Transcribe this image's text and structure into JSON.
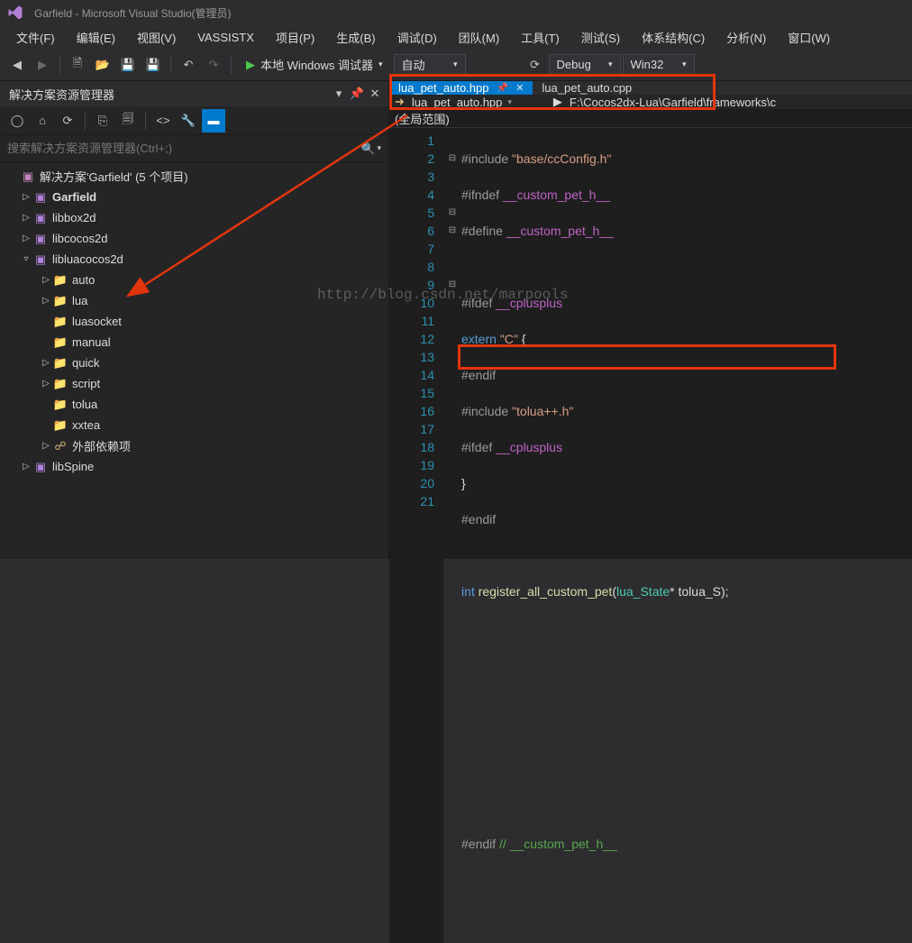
{
  "title": "Garfield - Microsoft Visual Studio(管理员)",
  "menus": {
    "file": "文件(F)",
    "edit": "编辑(E)",
    "view": "视图(V)",
    "vassist": "VASSISTX",
    "project": "项目(P)",
    "build": "生成(B)",
    "debug": "调试(D)",
    "team": "团队(M)",
    "tools": "工具(T)",
    "test": "测试(S)",
    "arch": "体系结构(C)",
    "analyze": "分析(N)",
    "window": "窗口(W)"
  },
  "toolbar": {
    "run_label": "本地 Windows 调试器",
    "mode": "自动",
    "config": "Debug",
    "platform": "Win32"
  },
  "solution_panel": {
    "title": "解决方案资源管理器",
    "search_placeholder": "搜索解决方案资源管理器(Ctrl+;)",
    "solution": "解决方案'Garfield' (5 个项目)",
    "items": [
      {
        "label": "Garfield",
        "kind": "proj",
        "bold": true,
        "expand": "▷"
      },
      {
        "label": "libbox2d",
        "kind": "proj",
        "expand": "▷"
      },
      {
        "label": "libcocos2d",
        "kind": "proj",
        "expand": "▷"
      },
      {
        "label": "libluacocos2d",
        "kind": "proj",
        "expand": "▿"
      },
      {
        "label": "auto",
        "kind": "folder",
        "expand": "▷",
        "indent": 2
      },
      {
        "label": "lua",
        "kind": "folder",
        "expand": "▷",
        "indent": 2
      },
      {
        "label": "luasocket",
        "kind": "folder",
        "expand": "",
        "indent": 2
      },
      {
        "label": "manual",
        "kind": "folder",
        "expand": "",
        "indent": 2
      },
      {
        "label": "quick",
        "kind": "folder",
        "expand": "▷",
        "indent": 2
      },
      {
        "label": "script",
        "kind": "folder",
        "expand": "▷",
        "indent": 2
      },
      {
        "label": "tolua",
        "kind": "folder",
        "expand": "",
        "indent": 2
      },
      {
        "label": "xxtea",
        "kind": "folder",
        "expand": "",
        "indent": 2
      },
      {
        "label": "外部依赖项",
        "kind": "ref",
        "expand": "▷",
        "indent": 2
      },
      {
        "label": "libSpine",
        "kind": "proj",
        "expand": "▷"
      }
    ]
  },
  "editor": {
    "tabs": [
      {
        "label": "lua_pet_auto.hpp",
        "active": true,
        "pinned": true
      },
      {
        "label": "lua_pet_auto.cpp",
        "active": false
      }
    ],
    "nav_left": "lua_pet_auto.hpp",
    "nav_right": "F:\\Cocos2dx-Lua\\Garfield\\frameworks\\c",
    "scope": "(全局范围)",
    "numbers": [
      "1",
      "2",
      "3",
      "4",
      "5",
      "6",
      "7",
      "8",
      "9",
      "10",
      "11",
      "12",
      "13",
      "14",
      "15",
      "16",
      "17",
      "18",
      "19",
      "20",
      "21"
    ],
    "fold": [
      "",
      "⊟",
      "",
      "",
      "⊟",
      "⊟",
      "",
      "",
      "⊟",
      "",
      "",
      "",
      "",
      "",
      "",
      "",
      "",
      "",
      "",
      "",
      ""
    ]
  },
  "watermark": "http://blog.csdn.net/marpools"
}
